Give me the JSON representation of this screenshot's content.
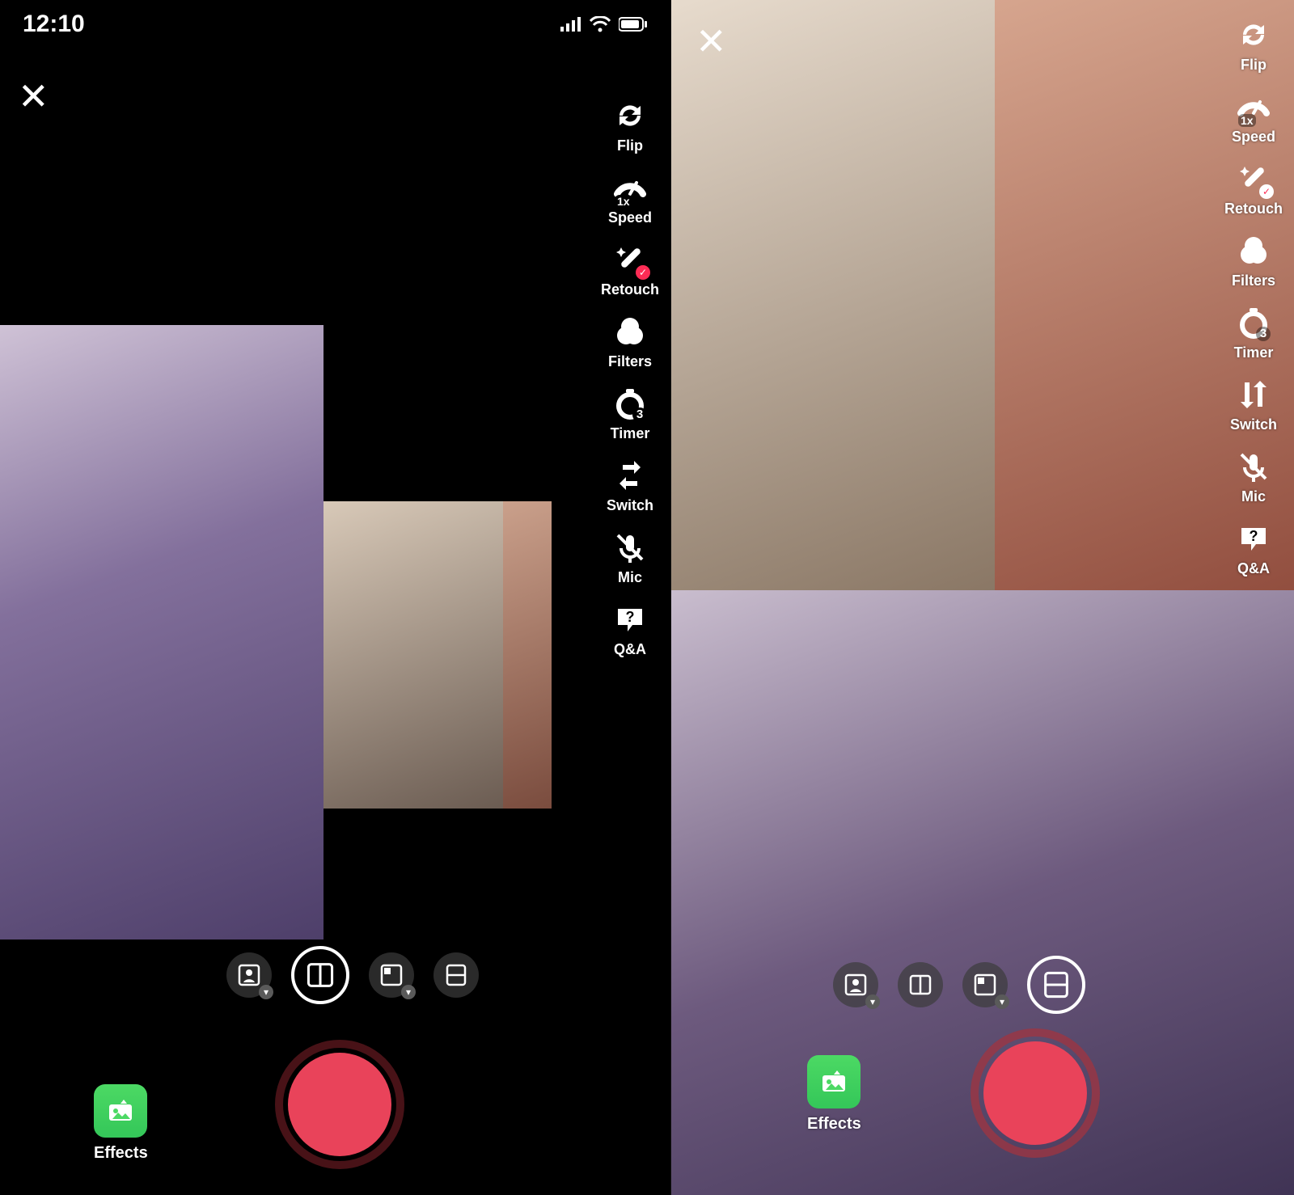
{
  "status": {
    "time": "12:10"
  },
  "close_glyph": "✕",
  "effects": {
    "label": "Effects"
  },
  "side_tools": [
    {
      "id": "flip",
      "label": "Flip"
    },
    {
      "id": "speed",
      "label": "Speed",
      "badge": "1x"
    },
    {
      "id": "retouch",
      "label": "Retouch",
      "checked": true
    },
    {
      "id": "filters",
      "label": "Filters"
    },
    {
      "id": "timer",
      "label": "Timer",
      "badge": "3"
    },
    {
      "id": "switch",
      "label": "Switch"
    },
    {
      "id": "mic",
      "label": "Mic"
    },
    {
      "id": "qa",
      "label": "Q&A"
    }
  ],
  "layout_options": [
    {
      "id": "greenscreen",
      "name": "green-screen-layout"
    },
    {
      "id": "side-by-side",
      "name": "side-by-side-layout"
    },
    {
      "id": "pip",
      "name": "picture-in-picture-layout"
    },
    {
      "id": "top-bottom",
      "name": "top-bottom-layout"
    }
  ],
  "left_screen": {
    "selected_layout": "side-by-side"
  },
  "right_screen": {
    "selected_layout": "top-bottom"
  }
}
